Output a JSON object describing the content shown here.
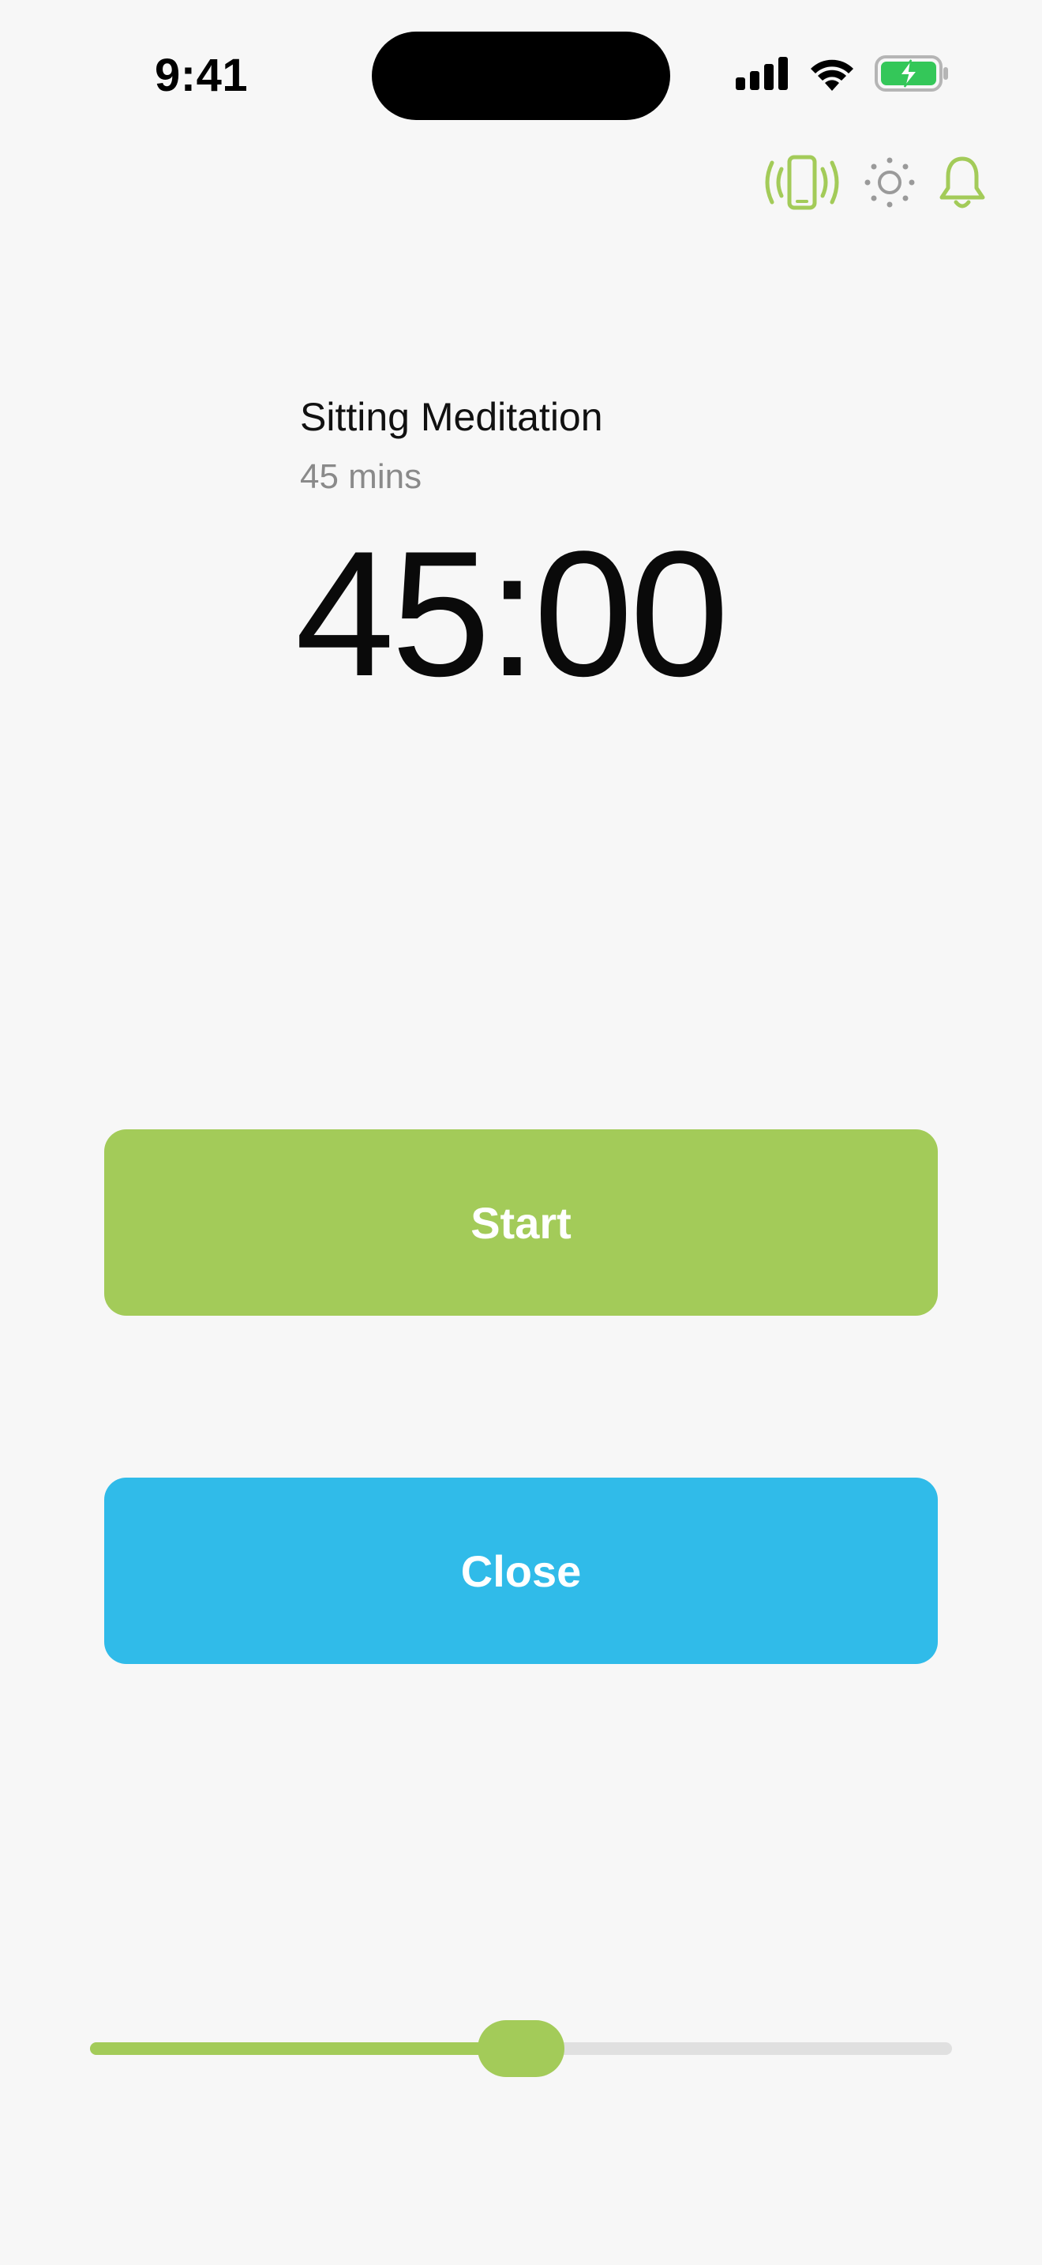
{
  "status_bar": {
    "time": "9:41",
    "battery_color": "#34c759",
    "icons": [
      "cellular-signal-icon",
      "wifi-icon",
      "battery-charging-icon"
    ]
  },
  "toolbar": {
    "icons": [
      "vibration-phone-icon",
      "brightness-icon",
      "bell-icon"
    ],
    "accent_color": "#a3cb59",
    "inactive_color": "#9a9a9a"
  },
  "session": {
    "title": "Sitting Meditation",
    "duration_label": "45 mins",
    "timer": "45:00"
  },
  "buttons": {
    "start_label": "Start",
    "start_color": "#a3cb59",
    "close_label": "Close",
    "close_color": "#30bbe9"
  },
  "slider": {
    "value_fraction": 0.5
  }
}
